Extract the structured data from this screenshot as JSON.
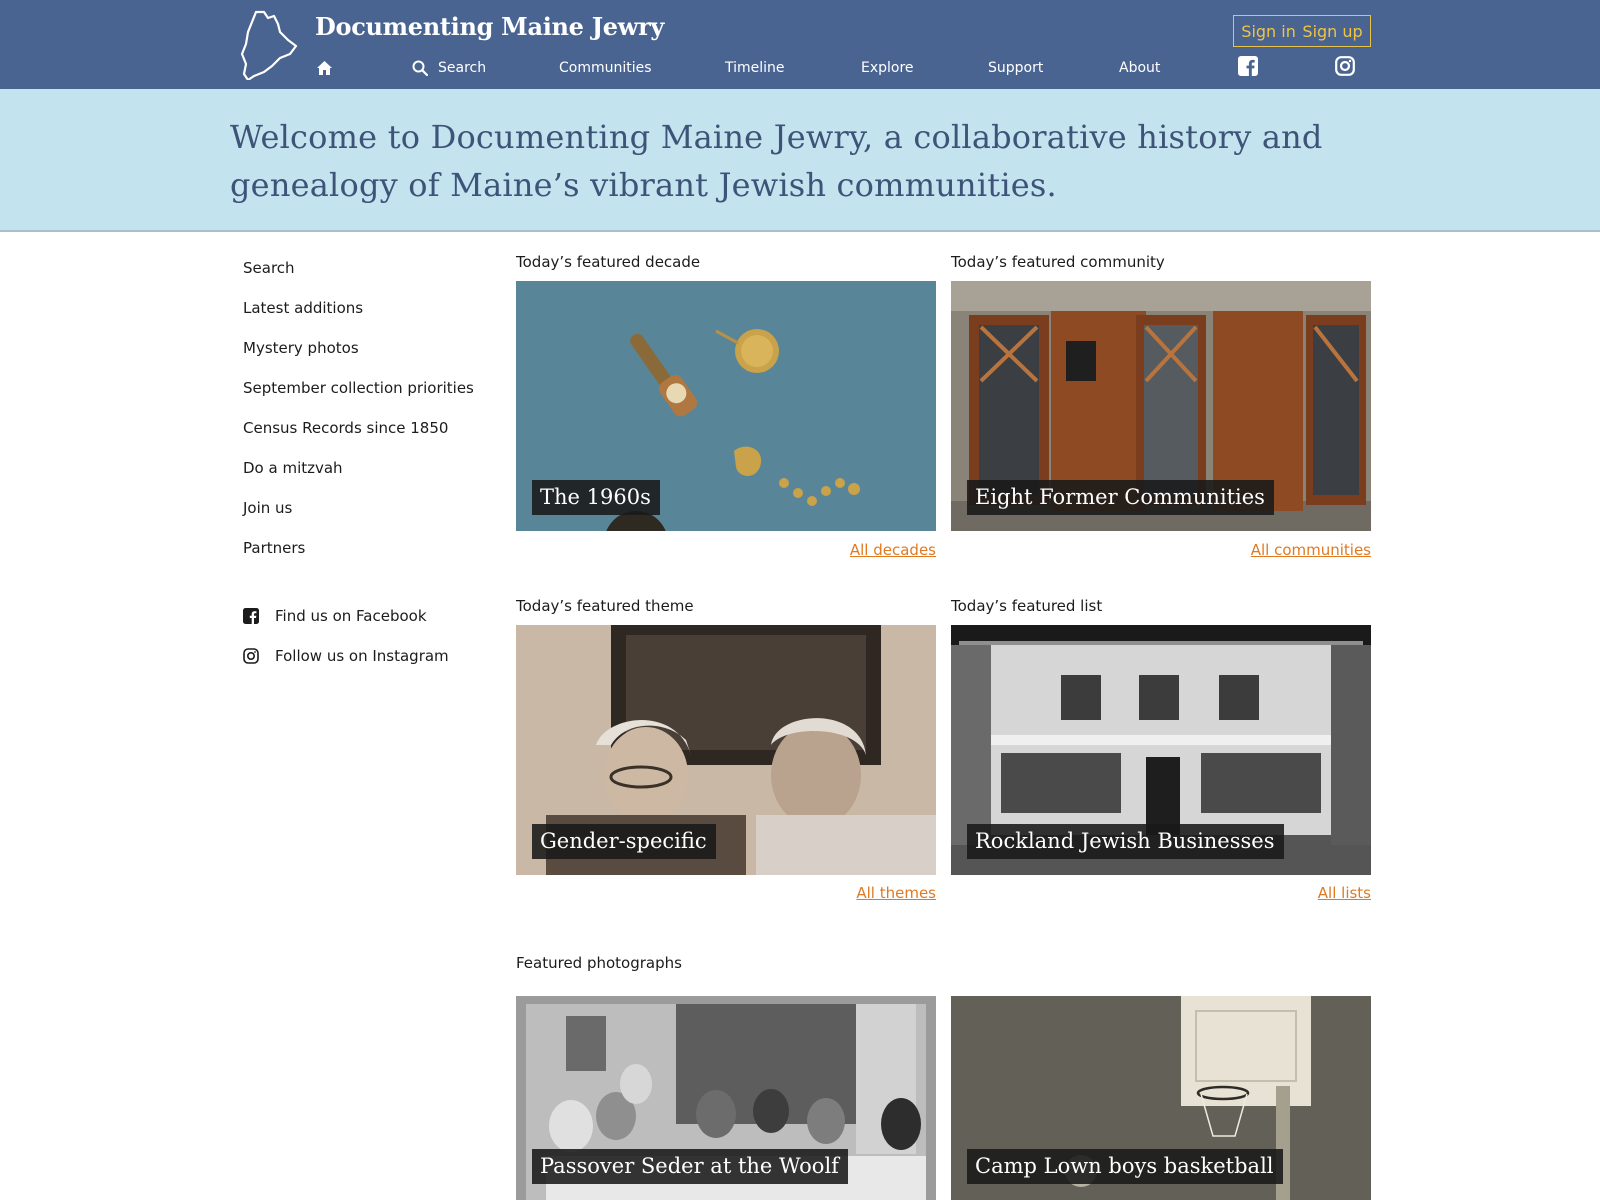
{
  "header": {
    "site_title": "Documenting Maine Jewry",
    "sign_in": "Sign in",
    "sign_up": "Sign up",
    "nav": {
      "home_icon": "home-icon",
      "search": "Search",
      "communities": "Communities",
      "timeline": "Timeline",
      "explore": "Explore",
      "support": "Support",
      "about": "About",
      "facebook_icon": "facebook-icon",
      "instagram_icon": "instagram-icon"
    }
  },
  "hero": {
    "text": "Welcome to Documenting Maine Jewry, a collaborative history and genealogy of Maine’s vibrant Jewish communities."
  },
  "sidebar": {
    "links": [
      "Search",
      "Latest additions",
      "Mystery photos",
      "September collection priorities",
      "Census Records since 1850",
      "Do a mitzvah",
      "Join us",
      "Partners"
    ],
    "social": [
      {
        "icon": "facebook-icon",
        "label": "Find us on Facebook"
      },
      {
        "icon": "instagram-icon",
        "label": "Follow us on Instagram"
      }
    ]
  },
  "featured": {
    "decade": {
      "label": "Today’s featured decade",
      "caption": "The 1960s",
      "all_link": "All decades"
    },
    "community": {
      "label": "Today’s featured community",
      "caption": "Eight Former Communities",
      "all_link": "All communities"
    },
    "theme": {
      "label": "Today’s featured theme",
      "caption": "Gender-specific",
      "all_link": "All themes"
    },
    "list": {
      "label": "Today’s featured list",
      "caption": "Rockland Jewish Businesses",
      "all_link": "All lists"
    }
  },
  "photos": {
    "label": "Featured photographs",
    "items": [
      {
        "caption": "Passover Seder at the Woolf"
      },
      {
        "caption": "Camp Lown boys basketball"
      }
    ]
  },
  "colors": {
    "header_bg": "#4a6491",
    "hero_bg": "#c3e3ef",
    "link_accent": "#e07a22",
    "auth_accent": "#f0c342"
  }
}
